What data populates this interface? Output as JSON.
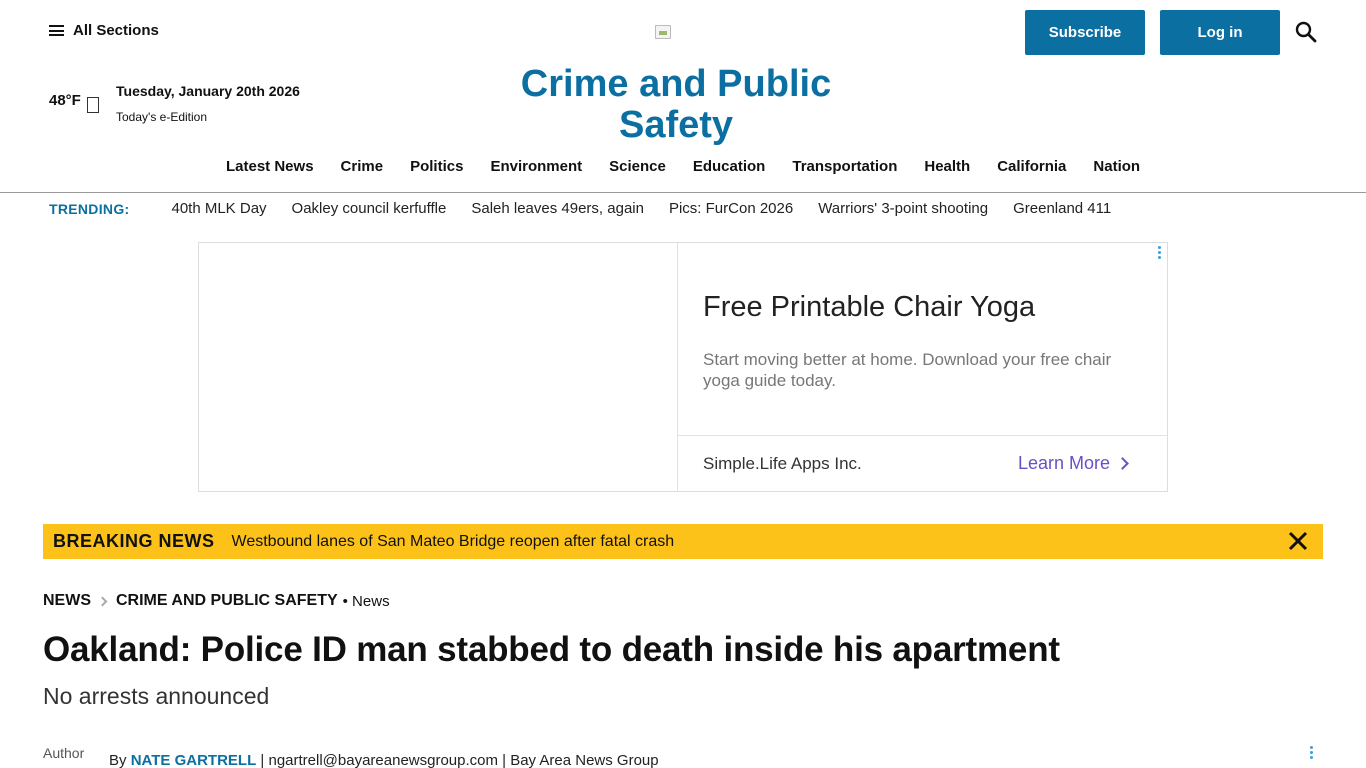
{
  "header": {
    "all_sections": "All Sections",
    "subscribe": "Subscribe",
    "login": "Log in",
    "temperature": "48°F",
    "date": "Tuesday, January 20th 2026",
    "edition": "Today's e-Edition",
    "section_title": "Crime and Public Safety"
  },
  "nav": {
    "items": [
      "Latest News",
      "Crime",
      "Politics",
      "Environment",
      "Science",
      "Education",
      "Transportation",
      "Health",
      "California",
      "Nation"
    ]
  },
  "trending": {
    "label": "TRENDING:",
    "items": [
      "40th MLK Day",
      "Oakley council kerfuffle",
      "Saleh leaves 49ers, again",
      "Pics: FurCon 2026",
      "Warriors' 3-point shooting",
      "Greenland 411"
    ]
  },
  "ad": {
    "title": "Free Printable Chair Yoga",
    "description": "Start moving better at home. Download your free chair yoga guide today.",
    "brand": "Simple.Life Apps Inc.",
    "cta": "Learn More",
    "cta_color": "#6a4fc7"
  },
  "breaking": {
    "label": "BREAKING NEWS",
    "text": "Westbound lanes of San Mateo Bridge reopen after fatal crash",
    "color": "#fdc21a"
  },
  "article": {
    "crumb1": "NEWS",
    "crumb2": "CRIME AND PUBLIC SAFETY",
    "crumb3": "• News",
    "headline": "Oakland: Police ID man stabbed to death inside his apartment",
    "subhead": "No arrests announced",
    "author_alt": "Author",
    "by": "By",
    "author_name": "NATE GARTRELL",
    "author_details": "| ngartrell@bayareanewsgroup.com | Bay Area News Group"
  },
  "colors": {
    "brand_blue": "#0b6fa1"
  }
}
